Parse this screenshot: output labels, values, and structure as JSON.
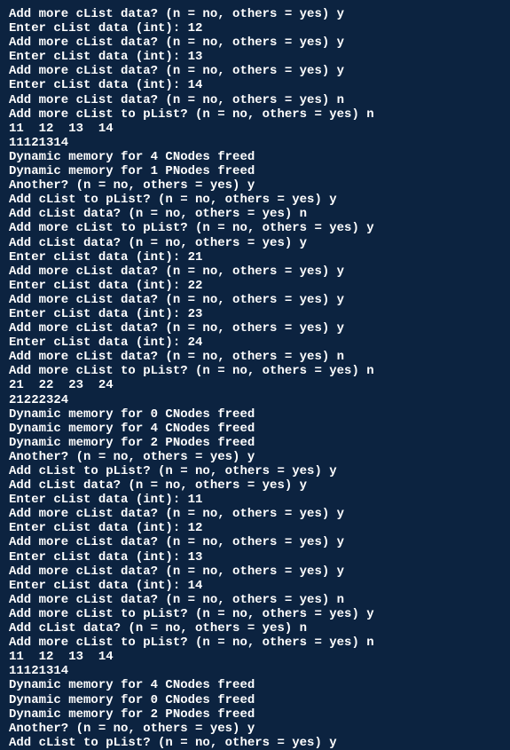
{
  "lines": [
    "Add more cList data? (n = no, others = yes) y",
    "Enter cList data (int): 12",
    "Add more cList data? (n = no, others = yes) y",
    "Enter cList data (int): 13",
    "Add more cList data? (n = no, others = yes) y",
    "Enter cList data (int): 14",
    "Add more cList data? (n = no, others = yes) n",
    "Add more cList to pList? (n = no, others = yes) n",
    "11  12  13  14",
    "11121314",
    "Dynamic memory for 4 CNodes freed",
    "Dynamic memory for 1 PNodes freed",
    "Another? (n = no, others = yes) y",
    "Add cList to pList? (n = no, others = yes) y",
    "Add cList data? (n = no, others = yes) n",
    "Add more cList to pList? (n = no, others = yes) y",
    "Add cList data? (n = no, others = yes) y",
    "Enter cList data (int): 21",
    "Add more cList data? (n = no, others = yes) y",
    "Enter cList data (int): 22",
    "Add more cList data? (n = no, others = yes) y",
    "Enter cList data (int): 23",
    "Add more cList data? (n = no, others = yes) y",
    "Enter cList data (int): 24",
    "Add more cList data? (n = no, others = yes) n",
    "Add more cList to pList? (n = no, others = yes) n",
    "21  22  23  24",
    "21222324",
    "Dynamic memory for 0 CNodes freed",
    "Dynamic memory for 4 CNodes freed",
    "Dynamic memory for 2 PNodes freed",
    "Another? (n = no, others = yes) y",
    "Add cList to pList? (n = no, others = yes) y",
    "Add cList data? (n = no, others = yes) y",
    "Enter cList data (int): 11",
    "Add more cList data? (n = no, others = yes) y",
    "Enter cList data (int): 12",
    "Add more cList data? (n = no, others = yes) y",
    "Enter cList data (int): 13",
    "Add more cList data? (n = no, others = yes) y",
    "Enter cList data (int): 14",
    "Add more cList data? (n = no, others = yes) n",
    "Add more cList to pList? (n = no, others = yes) y",
    "Add cList data? (n = no, others = yes) n",
    "Add more cList to pList? (n = no, others = yes) n",
    "11  12  13  14",
    "11121314",
    "Dynamic memory for 4 CNodes freed",
    "Dynamic memory for 0 CNodes freed",
    "Dynamic memory for 2 PNodes freed",
    "Another? (n = no, others = yes) y",
    "Add cList to pList? (n = no, others = yes) y"
  ]
}
